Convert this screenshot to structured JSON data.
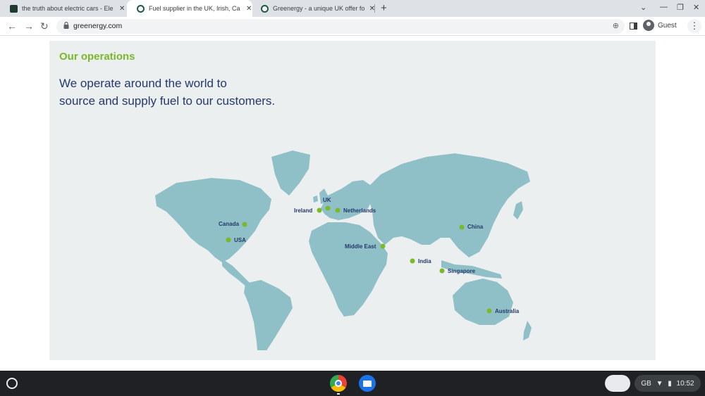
{
  "browser": {
    "tabs": [
      {
        "title": "the truth about electric cars - Ele",
        "active": false
      },
      {
        "title": "Fuel supplier in the UK, Irish, Ca",
        "active": true
      },
      {
        "title": "Greenergy - a unique UK offer fo",
        "active": false
      }
    ],
    "new_tab_label": "+",
    "url": "greenergy.com",
    "profile_label": "Guest"
  },
  "page": {
    "section_title": "Our operations",
    "headline_line1": "We operate around the world to",
    "headline_line2": "source and supply fuel to our customers.",
    "locations": [
      "UK",
      "Ireland",
      "Netherlands",
      "Canada",
      "USA",
      "China",
      "Middle East",
      "India",
      "Singapore",
      "Australia"
    ]
  },
  "taskbar": {
    "keyboard_layout": "GB",
    "time": "10:52"
  },
  "colors": {
    "accent_green": "#7ab929",
    "headline_blue": "#25396b",
    "map_land": "#8fbfc7",
    "panel_bg": "#ebefef"
  }
}
